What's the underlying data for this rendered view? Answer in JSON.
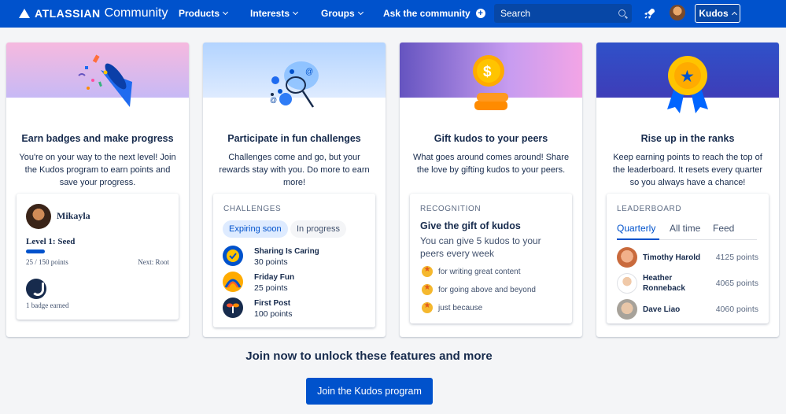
{
  "nav": {
    "brand": "ATLASSIAN",
    "community": "Community",
    "products": "Products",
    "interests": "Interests",
    "groups": "Groups",
    "ask": "Ask the community",
    "search_placeholder": "Search",
    "kudos": "Kudos"
  },
  "cards": {
    "badges": {
      "title": "Earn badges and make progress",
      "desc": "You're on your way to the next level! Join the Kudos program to earn points and save your progress.",
      "user_name": "Mikayla",
      "level": "Level 1: Seed",
      "progress_fraction": 0.0,
      "points": "25 / 150 points",
      "next": "Next: Root",
      "badges_earned": "1 badge earned"
    },
    "challenges": {
      "title": "Participate in fun challenges",
      "desc": "Challenges come and go, but your rewards stay with you. Do more to earn more!",
      "label": "CHALLENGES",
      "tab_expiring": "Expiring soon",
      "tab_progress": "In progress",
      "items": [
        {
          "name": "Sharing Is Caring",
          "points": "30 points"
        },
        {
          "name": "Friday Fun",
          "points": "25 points"
        },
        {
          "name": "First Post",
          "points": "100 points"
        }
      ]
    },
    "kudos": {
      "title": "Gift kudos to your peers",
      "desc": "What goes around comes around! Share the love by gifting kudos to your peers.",
      "label": "RECOGNITION",
      "gift_title": "Give the gift of kudos",
      "gift_sub": "You can give 5 kudos to your peers every week",
      "reasons": [
        "for writing great content",
        "for going above and beyond",
        "just because"
      ]
    },
    "ranks": {
      "title": "Rise up in the ranks",
      "desc": "Keep earning points to reach the top of the leaderboard. It resets every quarter so you always have a chance!",
      "label": "LEADERBOARD",
      "tab_quarterly": "Quarterly",
      "tab_alltime": "All time",
      "tab_feed": "Feed",
      "leaders": [
        {
          "name": "Timothy Harold",
          "points": "4125 points"
        },
        {
          "name": "Heather Ronneback",
          "points": "4065 points"
        },
        {
          "name": "Dave Liao",
          "points": "4060 points"
        }
      ]
    }
  },
  "join": {
    "text": "Join now to unlock these features and more",
    "button": "Join the Kudos program"
  }
}
